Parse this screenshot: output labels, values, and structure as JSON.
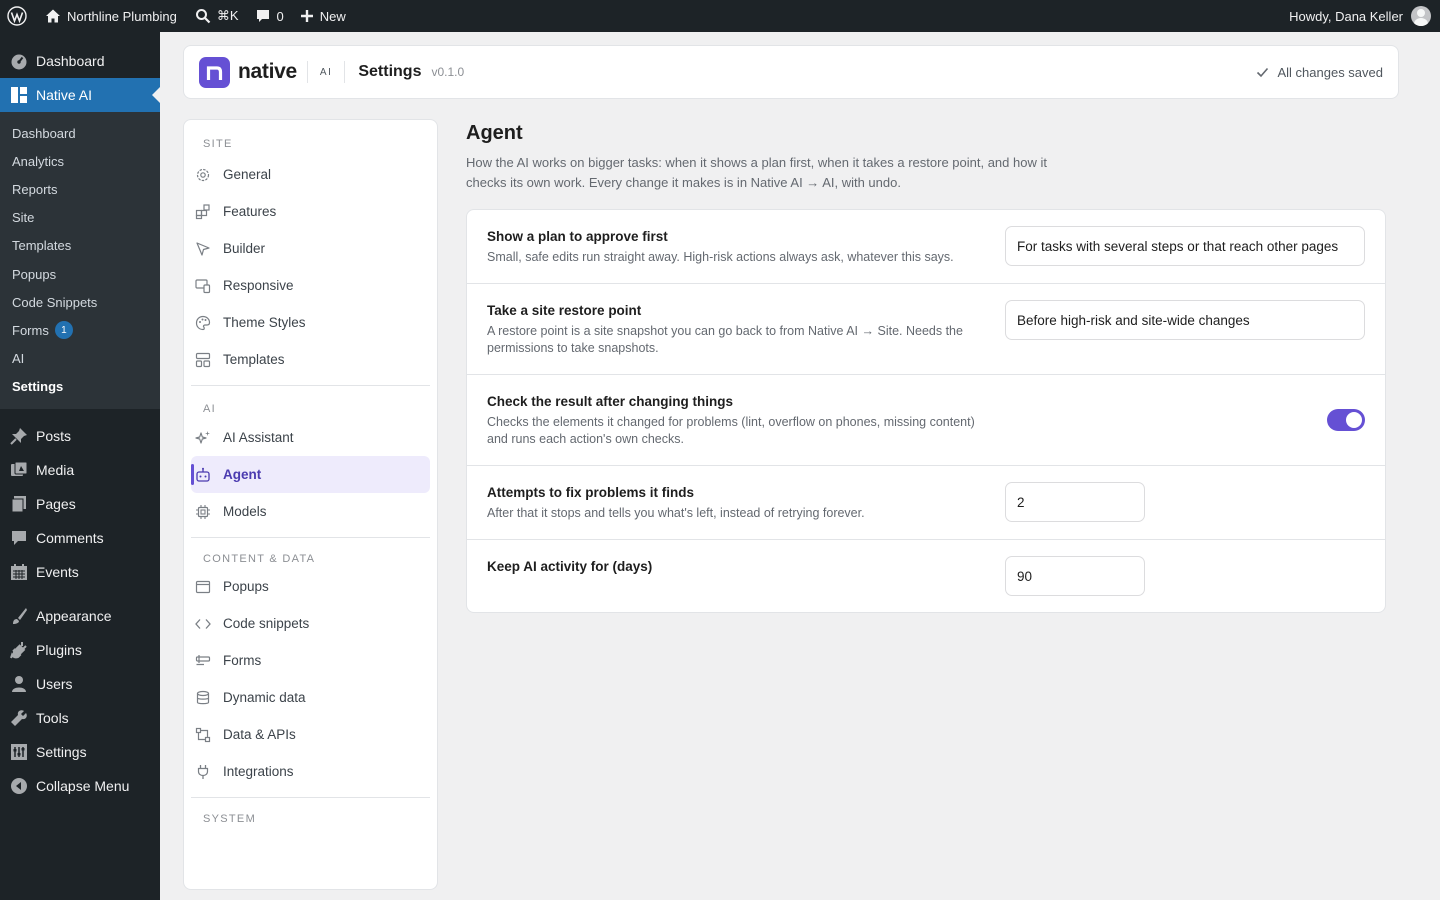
{
  "adminbar": {
    "site_name": "Northline Plumbing",
    "search_shortcut": "⌘K",
    "comments_count": "0",
    "new_label": "New",
    "howdy": "Howdy, Dana Keller"
  },
  "menu": {
    "dashboard": "Dashboard",
    "native_ai": "Native AI",
    "submenu": [
      {
        "label": "Dashboard"
      },
      {
        "label": "Analytics"
      },
      {
        "label": "Reports"
      },
      {
        "label": "Site"
      },
      {
        "label": "Templates"
      },
      {
        "label": "Popups"
      },
      {
        "label": "Code Snippets"
      },
      {
        "label": "Forms",
        "badge": "1"
      },
      {
        "label": "AI"
      },
      {
        "label": "Settings"
      }
    ],
    "posts": "Posts",
    "media": "Media",
    "pages": "Pages",
    "comments": "Comments",
    "events": "Events",
    "appearance": "Appearance",
    "plugins": "Plugins",
    "users": "Users",
    "tools": "Tools",
    "settings": "Settings",
    "collapse": "Collapse Menu"
  },
  "header": {
    "logo_text": "native",
    "ai_chip": "AI",
    "title": "Settings",
    "version": "v0.1.0",
    "saved_status": "All changes saved"
  },
  "settings_nav": {
    "site_heading": "SITE",
    "site_items": [
      "General",
      "Features",
      "Builder",
      "Responsive",
      "Theme Styles",
      "Templates"
    ],
    "ai_heading": "AI",
    "ai_items": [
      "AI Assistant",
      "Agent",
      "Models"
    ],
    "content_heading": "CONTENT & DATA",
    "content_items": [
      "Popups",
      "Code snippets",
      "Forms",
      "Dynamic data",
      "Data & APIs",
      "Integrations"
    ],
    "system_heading": "SYSTEM"
  },
  "main": {
    "title": "Agent",
    "description": "How the AI works on bigger tasks: when it shows a plan first, when it takes a restore point, and how it checks its own work. Every change it makes is in Native AI → AI, with undo.",
    "rows": [
      {
        "label": "Show a plan to approve first",
        "help": "Small, safe edits run straight away. High-risk actions always ask, whatever this says.",
        "value": "For tasks with several steps or that reach other pages"
      },
      {
        "label": "Take a site restore point",
        "help": "A restore point is a site snapshot you can go back to from Native AI → Site. Needs the permissions to take snapshots.",
        "value": "Before high-risk and site-wide changes"
      },
      {
        "label": "Check the result after changing things",
        "help": "Checks the elements it changed for problems (lint, overflow on phones, missing content) and runs each action's own checks.",
        "toggle_on": true
      },
      {
        "label": "Attempts to fix problems it finds",
        "help": "After that it stops and tells you what's left, instead of retrying forever.",
        "value": "2"
      },
      {
        "label": "Keep AI activity for (days)",
        "value": "90"
      }
    ]
  },
  "colors": {
    "accent": "#6550d4",
    "wp_blue": "#2271b1",
    "admin_dark": "#1d2327"
  }
}
